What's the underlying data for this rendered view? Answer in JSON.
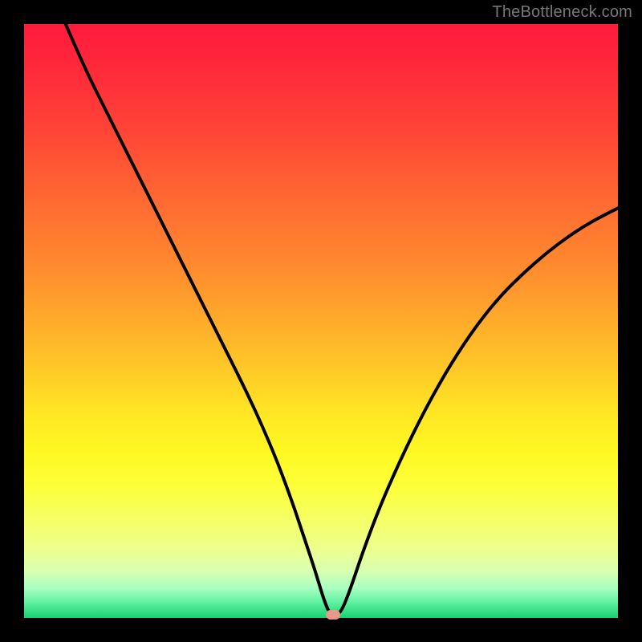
{
  "watermark": "TheBottleneck.com",
  "chart_data": {
    "type": "line",
    "title": "",
    "xlabel": "",
    "ylabel": "",
    "xlim": [
      0,
      100
    ],
    "ylim": [
      0,
      100
    ],
    "grid": false,
    "legend": false,
    "series": [
      {
        "name": "bottleneck-curve",
        "x": [
          7,
          10,
          14,
          18,
          22,
          26,
          30,
          34,
          38,
          42,
          45,
          47,
          49,
          50.5,
          51.5,
          52.5,
          53.5,
          55,
          57,
          60,
          64,
          68,
          72,
          76,
          80,
          84,
          88,
          92,
          96,
          100
        ],
        "y": [
          100,
          93,
          85,
          77,
          69,
          61,
          53,
          45,
          37,
          28,
          20,
          14,
          8,
          3,
          0.6,
          0.4,
          1.2,
          5,
          11,
          19,
          28,
          36,
          43,
          49,
          54,
          58,
          61.5,
          64.5,
          67,
          69
        ]
      }
    ],
    "minimum_marker": {
      "x": 52,
      "y": 0.5
    },
    "gradient_stops": [
      {
        "pos": 0,
        "color": "#ff1a3c"
      },
      {
        "pos": 8,
        "color": "#ff2a3a"
      },
      {
        "pos": 18,
        "color": "#ff4536"
      },
      {
        "pos": 30,
        "color": "#ff6a32"
      },
      {
        "pos": 42,
        "color": "#ff8e2e"
      },
      {
        "pos": 52,
        "color": "#ffb22a"
      },
      {
        "pos": 60,
        "color": "#ffd026"
      },
      {
        "pos": 66,
        "color": "#ffe824"
      },
      {
        "pos": 72,
        "color": "#fff823"
      },
      {
        "pos": 78,
        "color": "#fdff3a"
      },
      {
        "pos": 83,
        "color": "#f6ff62"
      },
      {
        "pos": 88,
        "color": "#efff8a"
      },
      {
        "pos": 92,
        "color": "#d9ffb0"
      },
      {
        "pos": 95,
        "color": "#a8ffc0"
      },
      {
        "pos": 97.5,
        "color": "#5cf0a0"
      },
      {
        "pos": 100,
        "color": "#18d070"
      }
    ],
    "marker_color": "#e8998b",
    "curve_color": "#000000"
  }
}
